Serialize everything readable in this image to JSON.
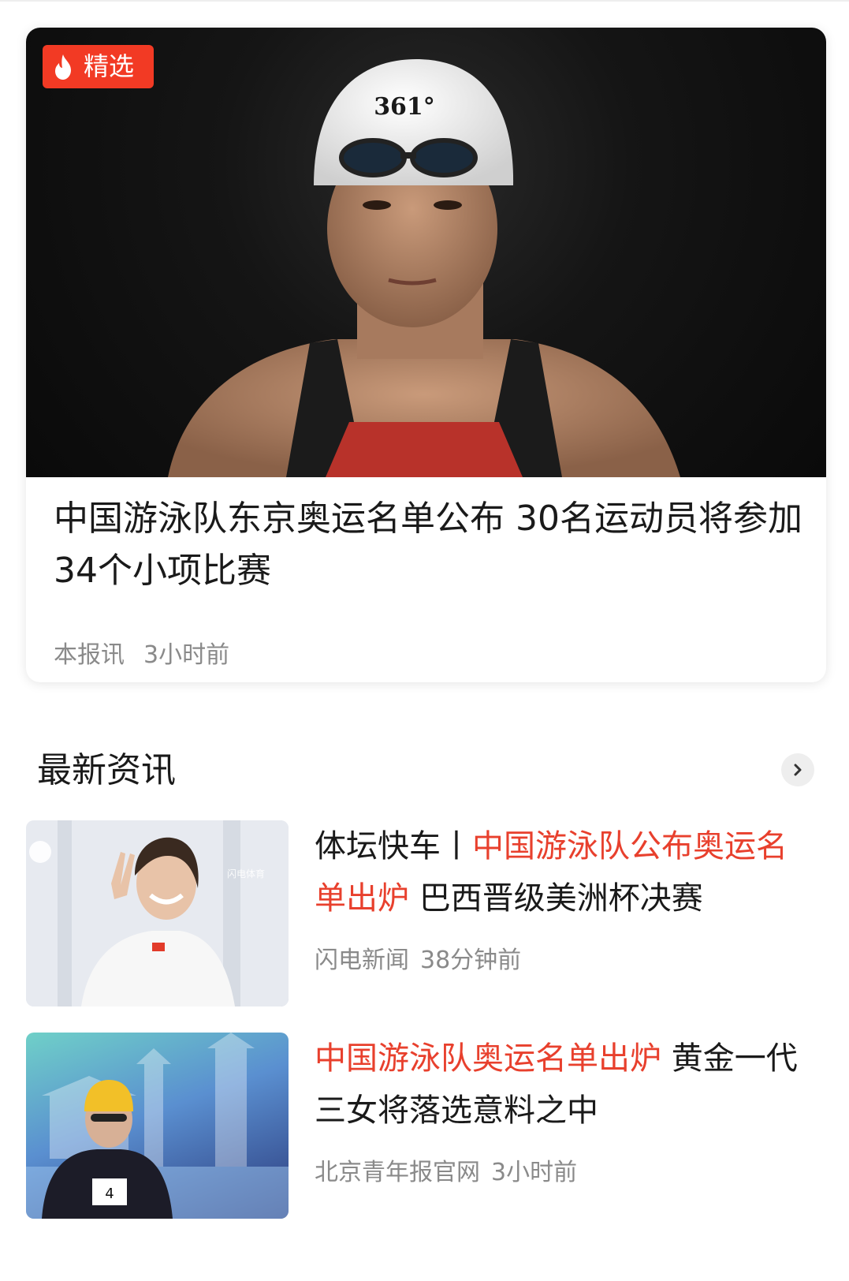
{
  "featured": {
    "badge": "精选",
    "badge_icon": "flame-icon",
    "title": "中国游泳队东京奥运名单公布 30名运动员将参加34个小项比赛",
    "source": "本报讯",
    "time": "3小时前",
    "cap_text": "361°"
  },
  "latest": {
    "section_title": "最新资讯",
    "more_icon": "chevron-right-icon",
    "items": [
      {
        "title_prefix": "体坛快车丨",
        "title_highlight": "中国游泳队公布奥运名单出炉",
        "title_suffix": " 巴西晋级美洲杯决赛",
        "source": "闪电新闻",
        "time": "38分钟前",
        "watermark": "闪电体育"
      },
      {
        "title_prefix": "",
        "title_highlight": "中国游泳队奥运名单出炉",
        "title_suffix": " 黄金一代三女将落选意料之中",
        "source": "北京青年报官网",
        "time": "3小时前",
        "bib_number": "4"
      }
    ]
  },
  "colors": {
    "accent": "#f23a24",
    "highlight": "#e8402d",
    "text": "#1a1a1a",
    "meta": "#8a8a8a"
  }
}
